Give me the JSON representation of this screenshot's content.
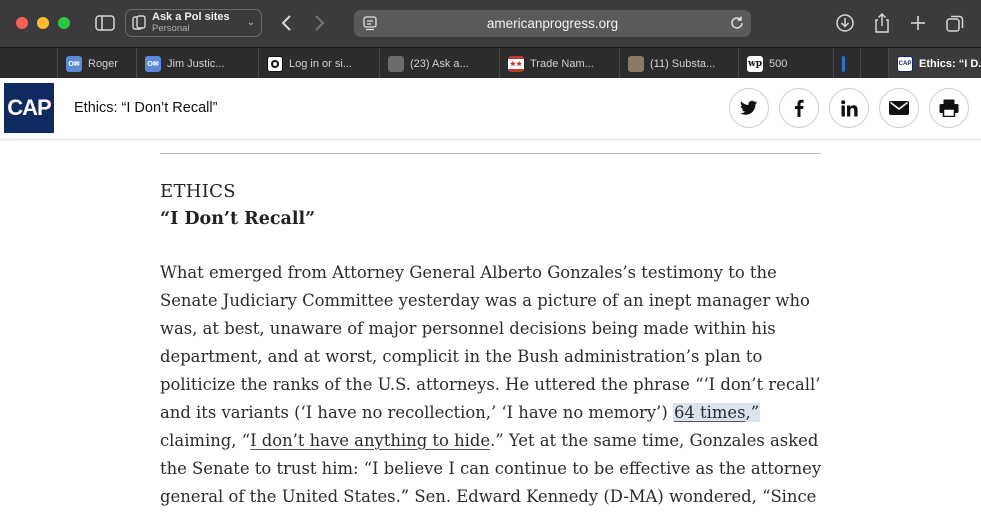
{
  "browser": {
    "tab_group": {
      "title": "Ask a Pol sites",
      "subtitle": "Personal"
    },
    "address": "americanprogress.org",
    "tabs": [
      {
        "label": "Roger",
        "fav_color": "#5b8bd6",
        "fav_text": "OH"
      },
      {
        "label": "Jim Justic...",
        "fav_color": "#5b8bd6",
        "fav_text": "OH"
      },
      {
        "label": "Log in or si...",
        "fav_color": "#111111",
        "fav_text": ""
      },
      {
        "label": "(23) Ask a...",
        "fav_color": "#6b6b6b",
        "fav_text": ""
      },
      {
        "label": "Trade Nam...",
        "fav_color": "#c0392b",
        "fav_text": ""
      },
      {
        "label": "(11) Substa...",
        "fav_color": "#8a7a66",
        "fav_text": ""
      },
      {
        "label": "500",
        "fav_color": "#ffffff",
        "fav_text": "wp"
      },
      {
        "label": "",
        "fav_color": "#2f6fd6",
        "fav_text": ""
      },
      {
        "label": "Ethics: “I D...",
        "fav_color": "#0e2a5e",
        "fav_text": "CAP"
      }
    ]
  },
  "site": {
    "logo_text": "CAP",
    "header_title": "Ethics: “I Don’t Recall”",
    "social_icons": [
      "twitter-icon",
      "facebook-icon",
      "linkedin-icon",
      "email-icon",
      "print-icon"
    ]
  },
  "article": {
    "kicker": "ETHICS",
    "headline": "“I Don’t Recall”",
    "l1": "What emerged from Attorney General Alberto Gonzales’s testimony to the",
    "l2": "Senate Judiciary Committee yesterday was a picture of an inept manager who",
    "l3": "was, at best, unaware of major personnel decisions being made within his",
    "l4": "department, and at worst, complicit in the Bush administration’s plan to",
    "l5": "politicize the ranks of the U.S. attorneys. He uttered the phrase “‘I don’t recall’",
    "l6_pre": "and its variants (‘I have no recollection,’ ‘I have no memory’) ",
    "l6_link": "64 times",
    "l6_post": ",”",
    "l7_pre": "claiming, “",
    "l7_link": "I don’t have anything to hide",
    "l7_post": ".” Yet at the same time, Gonzales asked",
    "l8": "the Senate to trust him: “I believe I can continue to be effective as the attorney",
    "l9": "general of the United States.” Sen. Edward Kennedy (D-MA) wondered, “Since"
  }
}
